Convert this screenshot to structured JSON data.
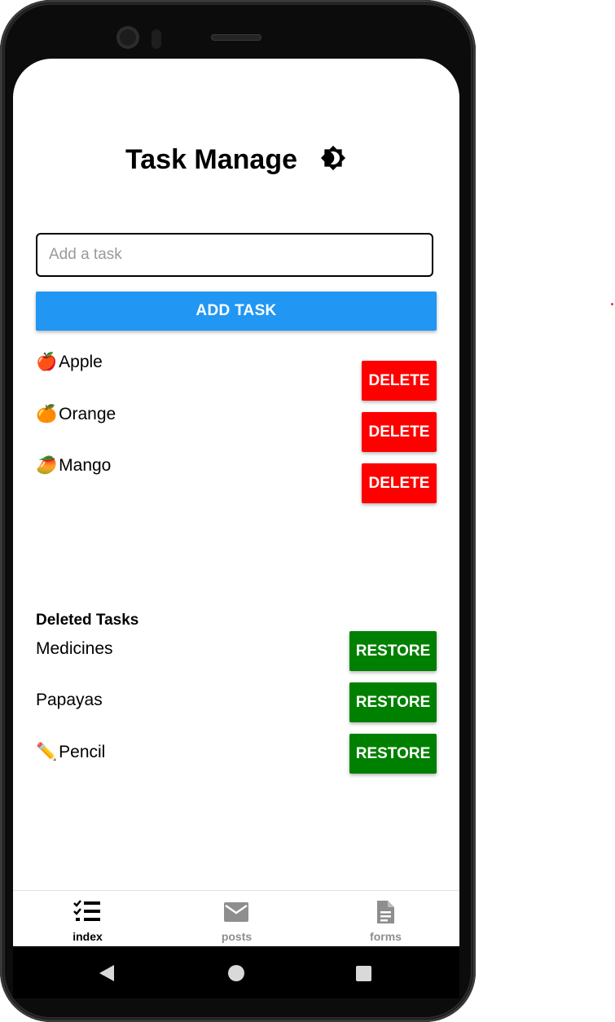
{
  "app": {
    "title": "Task Manage",
    "theme_icon": "brightness-toggle-icon"
  },
  "input": {
    "placeholder": "Add a task",
    "value": ""
  },
  "add_button_label": "ADD TASK",
  "tasks": [
    {
      "emoji": "🍎",
      "label": "Apple",
      "button": "DELETE"
    },
    {
      "emoji": "🍊",
      "label": "Orange",
      "button": "DELETE"
    },
    {
      "emoji": "🥭",
      "label": "Mango",
      "button": "DELETE"
    }
  ],
  "deleted_section_title": "Deleted Tasks",
  "deleted_tasks": [
    {
      "emoji": "",
      "label": "Medicines",
      "button": "RESTORE"
    },
    {
      "emoji": "",
      "label": "Papayas",
      "button": "RESTORE"
    },
    {
      "emoji": "✏️",
      "label": "Pencil",
      "button": "RESTORE"
    }
  ],
  "tabs": [
    {
      "label": "index",
      "icon": "checklist-icon",
      "active": true
    },
    {
      "label": "posts",
      "icon": "mail-icon",
      "active": false
    },
    {
      "label": "forms",
      "icon": "document-icon",
      "active": false
    }
  ],
  "colors": {
    "add_button": "#2196f3",
    "delete_button": "#ff0000",
    "restore_button": "#008000"
  }
}
